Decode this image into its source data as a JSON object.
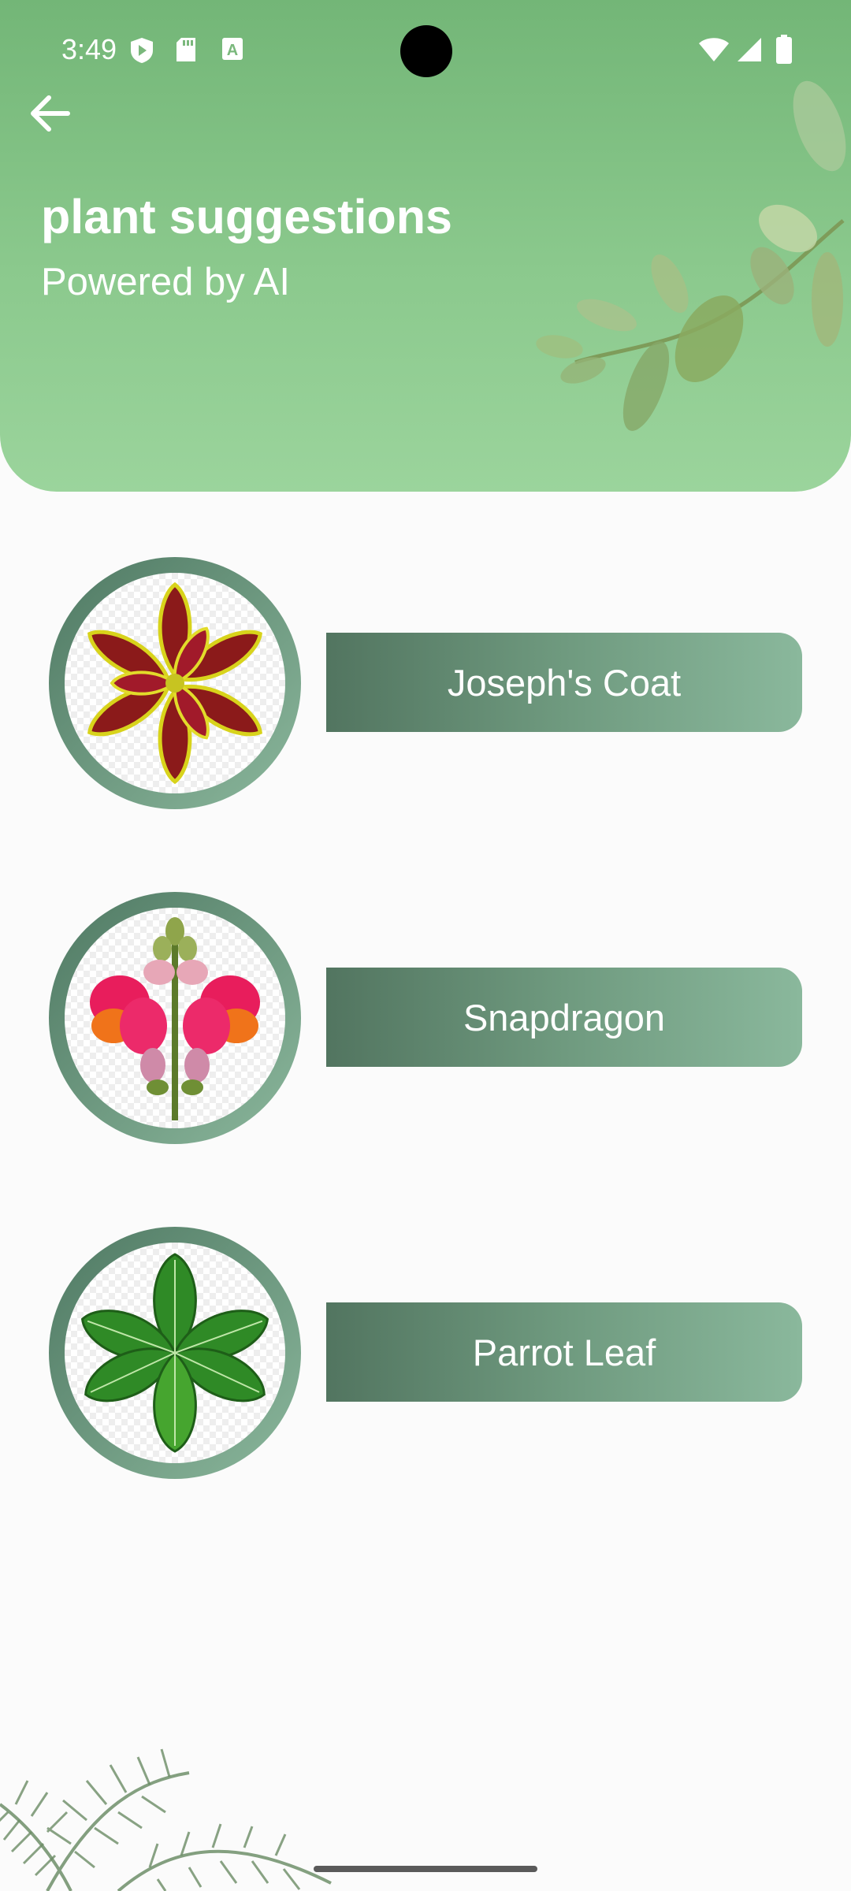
{
  "status_bar": {
    "time": "3:49",
    "left_icons": [
      "shield-play-icon",
      "sd-card-icon",
      "a-box-icon"
    ],
    "right_icons": [
      "wifi-icon",
      "signal-icon",
      "battery-icon"
    ]
  },
  "header": {
    "back_icon": "arrow-left-icon",
    "title": "plant suggestions",
    "subtitle": "Powered by AI",
    "gradient_colors": [
      "#73b677",
      "#9bd49c"
    ]
  },
  "suggestions": [
    {
      "name": "Joseph's Coat"
    },
    {
      "name": "Snapdragon"
    },
    {
      "name": "Parrot Leaf"
    }
  ],
  "colors": {
    "button_gradient": [
      "#527560",
      "#8ab89c"
    ],
    "ring": "#5f8a72"
  }
}
